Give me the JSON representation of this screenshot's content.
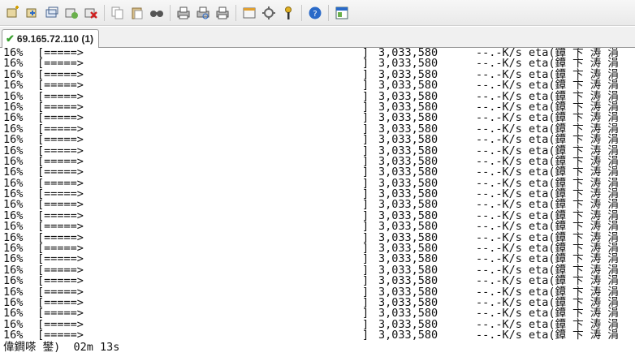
{
  "toolbar": {
    "icons": [
      "new-session-icon",
      "open-session-icon",
      "duplicate-session-icon",
      "reconnect-icon",
      "disconnect-icon",
      "copy-icon",
      "paste-icon",
      "find-icon",
      "print-setup-icon",
      "print-preview-icon",
      "print-icon",
      "properties-icon",
      "settings-icon",
      "key-icon",
      "help-icon",
      "window-icon"
    ]
  },
  "tab": {
    "label": "69.165.72.110 (1)",
    "status_color": "#3aa030"
  },
  "terminal": {
    "lines": [
      {
        "pct": "16%",
        "bar": "[=====>",
        "end": "]",
        "size": "3,033,580",
        "rate": "--.-K/s eta(鐔 卞 涛 涓"
      },
      {
        "pct": "16%",
        "bar": "[=====>",
        "end": "]",
        "size": "3,033,580",
        "rate": "--.-K/s eta(鐔 卞 涛 涓"
      },
      {
        "pct": "16%",
        "bar": "[=====>",
        "end": "]",
        "size": "3,033,580",
        "rate": "--.-K/s eta(鐔 卞 涛 涓"
      },
      {
        "pct": "16%",
        "bar": "[=====>",
        "end": "]",
        "size": "3,033,580",
        "rate": "--.-K/s eta(鐔 卞 涛 涓"
      },
      {
        "pct": "16%",
        "bar": "[=====>",
        "end": "]",
        "size": "3,033,580",
        "rate": "--.-K/s eta(鐔 卞 涛 涓"
      },
      {
        "pct": "16%",
        "bar": "[=====>",
        "end": "]",
        "size": "3,033,580",
        "rate": "--.-K/s eta(鐔 卞 涛 涓"
      },
      {
        "pct": "16%",
        "bar": "[=====>",
        "end": "]",
        "size": "3,033,580",
        "rate": "--.-K/s eta(鐔 卞 涛 涓"
      },
      {
        "pct": "16%",
        "bar": "[=====>",
        "end": "]",
        "size": "3,033,580",
        "rate": "--.-K/s eta(鐔 卞 涛 涓"
      },
      {
        "pct": "16%",
        "bar": "[=====>",
        "end": "]",
        "size": "3,033,580",
        "rate": "--.-K/s eta(鐔 卞 涛 涓"
      },
      {
        "pct": "16%",
        "bar": "[=====>",
        "end": "]",
        "size": "3,033,580",
        "rate": "--.-K/s eta(鐔 卞 涛 涓"
      },
      {
        "pct": "16%",
        "bar": "[=====>",
        "end": "]",
        "size": "3,033,580",
        "rate": "--.-K/s eta(鐔 卞 涛 涓"
      },
      {
        "pct": "16%",
        "bar": "[=====>",
        "end": "]",
        "size": "3,033,580",
        "rate": "--.-K/s eta(鐔 卞 涛 涓"
      },
      {
        "pct": "16%",
        "bar": "[=====>",
        "end": "]",
        "size": "3,033,580",
        "rate": "--.-K/s eta(鐔 卞 涛 涓"
      },
      {
        "pct": "16%",
        "bar": "[=====>",
        "end": "]",
        "size": "3,033,580",
        "rate": "--.-K/s eta(鐔 卞 涛 涓"
      },
      {
        "pct": "16%",
        "bar": "[=====>",
        "end": "]",
        "size": "3,033,580",
        "rate": "--.-K/s eta(鐔 卞 涛 涓"
      },
      {
        "pct": "16%",
        "bar": "[=====>",
        "end": "]",
        "size": "3,033,580",
        "rate": "--.-K/s eta(鐔 卞 涛 涓"
      },
      {
        "pct": "16%",
        "bar": "[=====>",
        "end": "]",
        "size": "3,033,580",
        "rate": "--.-K/s eta(鐔 卞 涛 涓"
      },
      {
        "pct": "16%",
        "bar": "[=====>",
        "end": "]",
        "size": "3,033,580",
        "rate": "--.-K/s eta(鐔 卞 涛 涓"
      },
      {
        "pct": "16%",
        "bar": "[=====>",
        "end": "]",
        "size": "3,033,580",
        "rate": "--.-K/s eta(鐔 卞 涛 涓"
      },
      {
        "pct": "16%",
        "bar": "[=====>",
        "end": "]",
        "size": "3,033,580",
        "rate": "--.-K/s eta(鐔 卞 涛 涓"
      },
      {
        "pct": "16%",
        "bar": "[=====>",
        "end": "]",
        "size": "3,033,580",
        "rate": "--.-K/s eta(鐔 卞 涛 涓"
      },
      {
        "pct": "16%",
        "bar": "[=====>",
        "end": "]",
        "size": "3,033,580",
        "rate": "--.-K/s eta(鐔 卞 涛 涓"
      },
      {
        "pct": "16%",
        "bar": "[=====>",
        "end": "]",
        "size": "3,033,580",
        "rate": "--.-K/s eta(鐔 卞 涛 涓"
      },
      {
        "pct": "16%",
        "bar": "[=====>",
        "end": "]",
        "size": "3,033,580",
        "rate": "--.-K/s eta(鐔 卞 涛 涓"
      },
      {
        "pct": "16%",
        "bar": "[=====>",
        "end": "]",
        "size": "3,033,580",
        "rate": "--.-K/s eta(鐔 卞 涛 涓"
      },
      {
        "pct": "16%",
        "bar": "[=====>",
        "end": "]",
        "size": "3,033,580",
        "rate": "--.-K/s eta(鐔 卞 涛 涓"
      },
      {
        "pct": "16%",
        "bar": "[=====>",
        "end": "]",
        "size": "3,033,580",
        "rate": "--.-K/s eta(鐔 卞 涛 涓"
      }
    ],
    "last_line": "偉鐧嗏 鐢)  02m 13s"
  }
}
